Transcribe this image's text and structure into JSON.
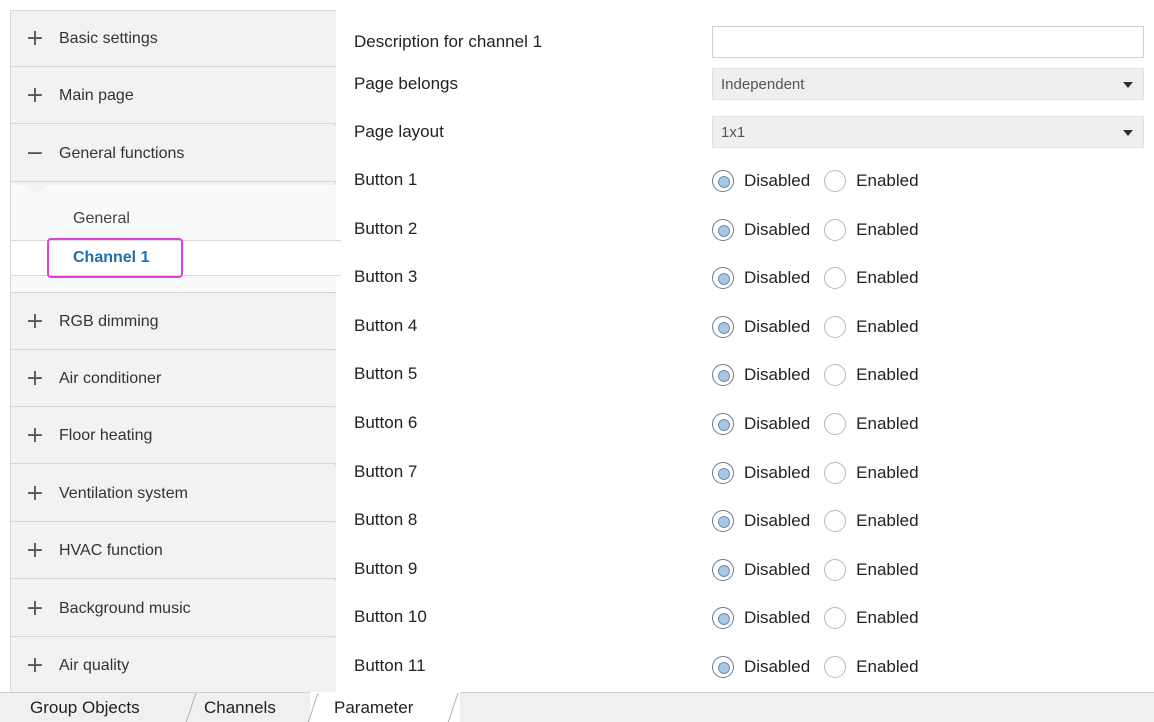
{
  "sidebar": {
    "top_items": [
      {
        "sign": "+",
        "label": "Basic settings"
      },
      {
        "sign": "+",
        "label": "Main page"
      },
      {
        "sign": "−",
        "label": "General functions"
      }
    ],
    "sub_items": [
      {
        "label": "General"
      },
      {
        "label": "Channel 1",
        "active": true
      }
    ],
    "bottom_items": [
      {
        "sign": "+",
        "label": "RGB dimming"
      },
      {
        "sign": "+",
        "label": "Air conditioner"
      },
      {
        "sign": "+",
        "label": "Floor heating"
      },
      {
        "sign": "+",
        "label": "Ventilation system"
      },
      {
        "sign": "+",
        "label": "HVAC function"
      },
      {
        "sign": "+",
        "label": "Background music"
      },
      {
        "sign": "+",
        "label": "Air quality"
      }
    ]
  },
  "form": {
    "description": {
      "label": "Description for channel 1",
      "value": ""
    },
    "page_belongs": {
      "label": "Page belongs",
      "value": "Independent"
    },
    "page_layout": {
      "label": "Page layout",
      "value": "1x1"
    },
    "option_disabled": "Disabled",
    "option_enabled": "Enabled",
    "buttons": [
      {
        "label": "Button 1",
        "selected": "Disabled"
      },
      {
        "label": "Button 2",
        "selected": "Disabled"
      },
      {
        "label": "Button 3",
        "selected": "Disabled"
      },
      {
        "label": "Button 4",
        "selected": "Disabled"
      },
      {
        "label": "Button 5",
        "selected": "Disabled"
      },
      {
        "label": "Button 6",
        "selected": "Disabled"
      },
      {
        "label": "Button 7",
        "selected": "Disabled"
      },
      {
        "label": "Button 8",
        "selected": "Disabled"
      },
      {
        "label": "Button 9",
        "selected": "Disabled"
      },
      {
        "label": "Button 10",
        "selected": "Disabled"
      },
      {
        "label": "Button 11",
        "selected": "Disabled"
      }
    ]
  },
  "tabs": [
    {
      "label": "Group Objects"
    },
    {
      "label": "Channels"
    },
    {
      "label": "Parameter",
      "active": true
    }
  ],
  "colors": {
    "active_link": "#1e6fb0",
    "highlight_border": "#e040e0",
    "radio_fill": "#a9c6e6"
  }
}
